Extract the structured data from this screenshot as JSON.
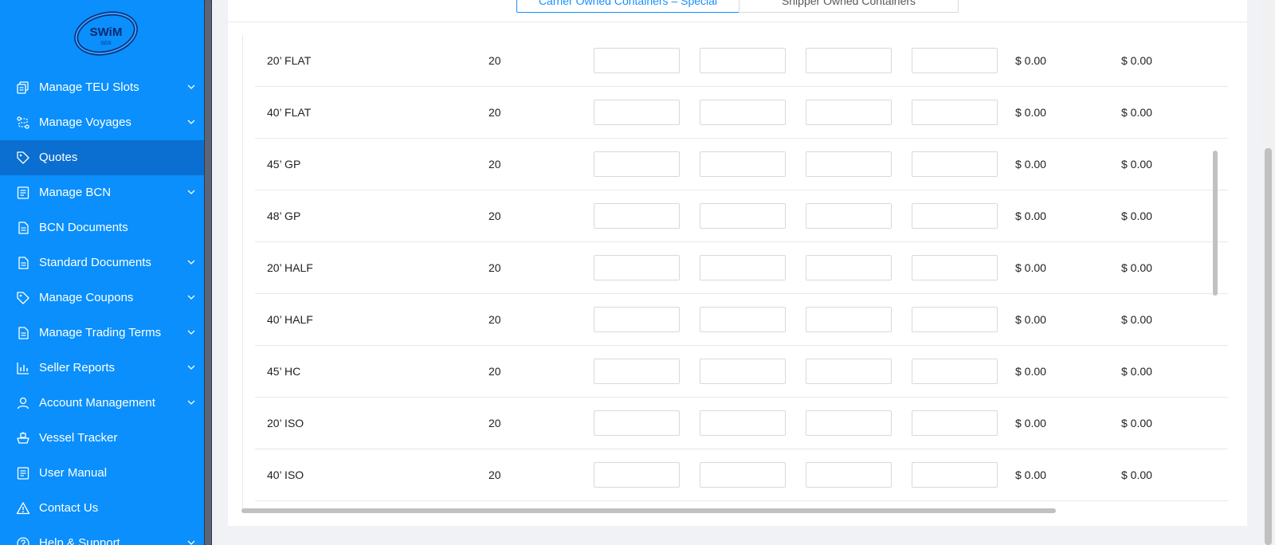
{
  "brand": {
    "logo_text": "SWiM",
    "logo_sub": "GDS"
  },
  "sidebar": {
    "items": [
      {
        "label": "Manage TEU Slots",
        "icon": "copy-icon",
        "has_chevron": true
      },
      {
        "label": "Manage Voyages",
        "icon": "route-icon",
        "has_chevron": true
      },
      {
        "label": "Quotes",
        "icon": "tag-icon",
        "has_chevron": false,
        "active": true
      },
      {
        "label": "Manage BCN",
        "icon": "list-doc-icon",
        "has_chevron": true
      },
      {
        "label": "BCN Documents",
        "icon": "document-icon",
        "has_chevron": false
      },
      {
        "label": "Standard Documents",
        "icon": "document-icon",
        "has_chevron": true
      },
      {
        "label": "Manage Coupons",
        "icon": "tag-icon",
        "has_chevron": true
      },
      {
        "label": "Manage Trading Terms",
        "icon": "document-icon",
        "has_chevron": true
      },
      {
        "label": "Seller Reports",
        "icon": "bar-chart-icon",
        "has_chevron": true
      },
      {
        "label": "Account Management",
        "icon": "user-icon",
        "has_chevron": true
      },
      {
        "label": "Vessel Tracker",
        "icon": "ship-icon",
        "has_chevron": false
      },
      {
        "label": "User Manual",
        "icon": "list-doc-icon",
        "has_chevron": false
      },
      {
        "label": "Contact Us",
        "icon": "warning-icon",
        "has_chevron": false
      },
      {
        "label": "Help & Support",
        "icon": "help-icon",
        "has_chevron": true
      }
    ]
  },
  "tabs": [
    {
      "label": "Carrier Owned Containers – Special",
      "active": true
    },
    {
      "label": "Shipper Owned Containers",
      "active": false
    }
  ],
  "rows": [
    {
      "type": "20’ FLAT",
      "qty": "20",
      "price1": "$ 0.00",
      "price2": "$ 0.00"
    },
    {
      "type": "40’ FLAT",
      "qty": "20",
      "price1": "$ 0.00",
      "price2": "$ 0.00"
    },
    {
      "type": "45’ GP",
      "qty": "20",
      "price1": "$ 0.00",
      "price2": "$ 0.00"
    },
    {
      "type": "48’ GP",
      "qty": "20",
      "price1": "$ 0.00",
      "price2": "$ 0.00"
    },
    {
      "type": "20’ HALF",
      "qty": "20",
      "price1": "$ 0.00",
      "price2": "$ 0.00"
    },
    {
      "type": "40’ HALF",
      "qty": "20",
      "price1": "$ 0.00",
      "price2": "$ 0.00"
    },
    {
      "type": "45’ HC",
      "qty": "20",
      "price1": "$ 0.00",
      "price2": "$ 0.00"
    },
    {
      "type": "20’ ISO",
      "qty": "20",
      "price1": "$ 0.00",
      "price2": "$ 0.00"
    },
    {
      "type": "40’ ISO",
      "qty": "20",
      "price1": "$ 0.00",
      "price2": "$ 0.00"
    }
  ],
  "colors": {
    "sidebar": "#0a8ffc",
    "active": "#0a6fd1",
    "accent": "#1890ff"
  }
}
